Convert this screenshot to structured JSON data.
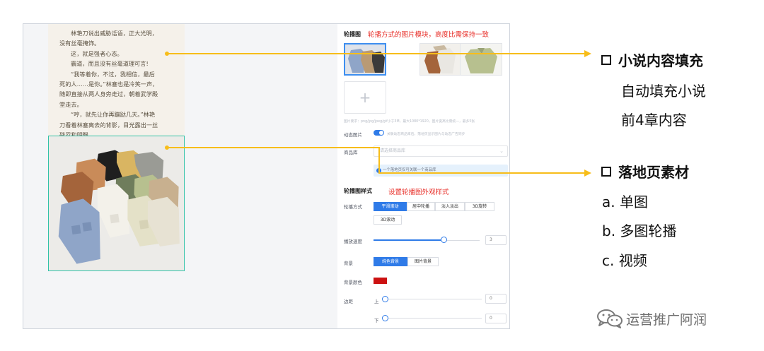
{
  "novel": {
    "lines": [
      "林艳刀说出威胁话语，正大光明，",
      "没有丝毫掩饰。",
      "这，就是强者心态。",
      "霸道，而且没有丝毫道理可言!",
      "“我等着你，不过，我相信，最后",
      "死的人……是你。”林塞也是冷笑一声，",
      "随即直接从两人身旁走过，朝着武学殿",
      "堂走去。",
      "“哼，就先让你再蹦跶几天。”林艳",
      "刀看着林塞离去的背影，目光露出一丝",
      "残忍和阴翳。"
    ]
  },
  "panel": {
    "carousel_title": "轮播图",
    "carousel_note": "轮播方式的图片模块，高度比需保持一致",
    "upload_plus": "+",
    "image_hint": "图片要求：png/jpg/jpeg/gif小于3M，最大1080*1920，图片宽高比需统一，最多5张",
    "dynamic_label": "动态图片",
    "dynamic_hint": "关联动态商品库后，落地页显示图片与动态广告同步",
    "product_lib_label": "商品库",
    "product_lib_placeholder": "请选择商品库",
    "info_icon": "!",
    "info_text": "一个落地页仅可关联一个商品库",
    "style_title": "轮播图样式",
    "style_note": "设置轮播图外观样式",
    "mode_label": "轮播方式",
    "modes": [
      "平滑滚动",
      "居中轮播",
      "淡入淡出",
      "3D旋转",
      "3D滚动"
    ],
    "speed_label": "播放速度",
    "speed_value": "3",
    "speed_level": 0.66,
    "bg_label": "背景",
    "bg_options": [
      "纯色背景",
      "图片背景"
    ],
    "bg_color_label": "背景颜色",
    "bg_color": "#cc1111",
    "margin_label": "边距",
    "margin_top_label": "上",
    "margin_top_value": "0",
    "margin_bottom_label": "下",
    "margin_bottom_value": "0"
  },
  "annotations": {
    "section1_title": "小说内容填充",
    "section1_lines": [
      "自动填充小说",
      "前4章内容"
    ],
    "section2_title": "落地页素材",
    "section2_items": [
      "a.  单图",
      "b.  多图轮播",
      "c.  视频"
    ]
  },
  "watermark": "运营推广阿润",
  "colors": {
    "accent": "#2f7be8",
    "callout": "#f7bd1a",
    "note_red": "#e8302a",
    "photo_border": "#31c2a7"
  }
}
